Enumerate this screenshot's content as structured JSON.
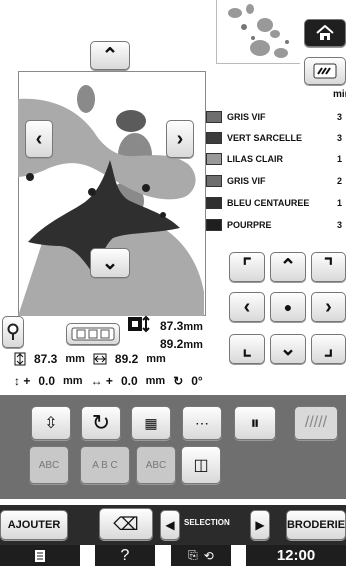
{
  "threads_header": "min",
  "threads": [
    {
      "name": "GRIS VIF",
      "count": "3",
      "color": "#6e6e6e"
    },
    {
      "name": "VERT SARCELLE",
      "count": "3",
      "color": "#3d3d3d"
    },
    {
      "name": "LILAS CLAIR",
      "count": "1",
      "color": "#9a9a9a"
    },
    {
      "name": "GRIS VIF",
      "count": "2",
      "color": "#6e6e6e"
    },
    {
      "name": "BLEU CENTAUREE",
      "count": "1",
      "color": "#2f2f2f"
    },
    {
      "name": "POURPRE",
      "count": "3",
      "color": "#1f1f1f"
    }
  ],
  "size": {
    "height": "87.3",
    "width": "89.2",
    "unit": "mm"
  },
  "measure": {
    "height": "87.3",
    "width": "89.2",
    "unit": "mm"
  },
  "offset": {
    "v": "0.0",
    "h": "0.0",
    "unit": "mm",
    "rotation": "0°"
  },
  "bottom": {
    "add": "AJOUTER",
    "selection": "SELECTION",
    "embroidery": "BRODERIE",
    "time": "12:00"
  },
  "accent": "#1f1f1f"
}
